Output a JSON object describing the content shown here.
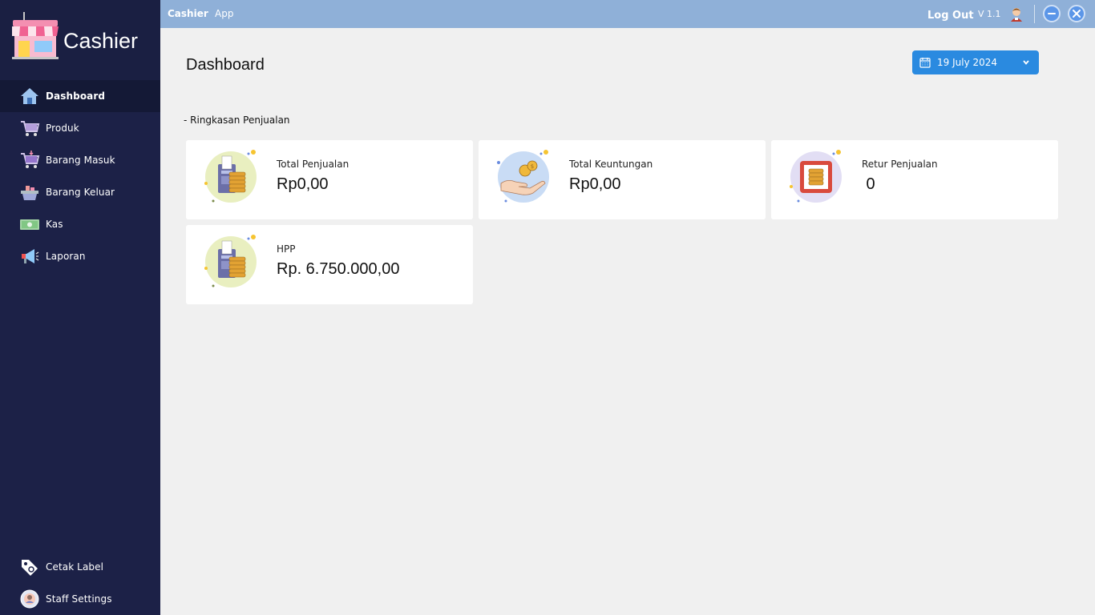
{
  "app": {
    "brand": "Cashier"
  },
  "topbar": {
    "title_bold": "Cashier",
    "title_rest": "App",
    "logout": "Log Out",
    "version": "V 1.1"
  },
  "sidebar": {
    "items": [
      {
        "label": "Dashboard",
        "icon": "home-icon",
        "active": true
      },
      {
        "label": "Produk",
        "icon": "cart-icon"
      },
      {
        "label": "Barang Masuk",
        "icon": "cart-in-icon"
      },
      {
        "label": "Barang Keluar",
        "icon": "basket-icon"
      },
      {
        "label": "Kas",
        "icon": "cash-icon"
      },
      {
        "label": "Laporan",
        "icon": "megaphone-icon"
      }
    ],
    "bottom": [
      {
        "label": "Cetak Label",
        "icon": "tag-icon"
      },
      {
        "label": "Staff Settings",
        "icon": "staff-icon"
      }
    ]
  },
  "main": {
    "title": "Dashboard",
    "date": "19 July 2024",
    "section": "- Ringkasan Penjualan",
    "cards": [
      {
        "title": "Total Penjualan",
        "value": "Rp0,00",
        "icon": "pos-coins-icon"
      },
      {
        "title": "Total Keuntungan",
        "value": "Rp0,00",
        "icon": "hand-coins-icon"
      },
      {
        "title": "Retur Penjualan",
        "value": " 0",
        "icon": "return-coins-icon"
      },
      {
        "title": "HPP",
        "value": "Rp. 6.750.000,00",
        "icon": "pos-coins-icon"
      }
    ]
  },
  "colors": {
    "sidebar": "#1c2147",
    "topbar": "#8fb0d8",
    "accent": "#2a8ae0",
    "background": "#f0f0f0"
  }
}
